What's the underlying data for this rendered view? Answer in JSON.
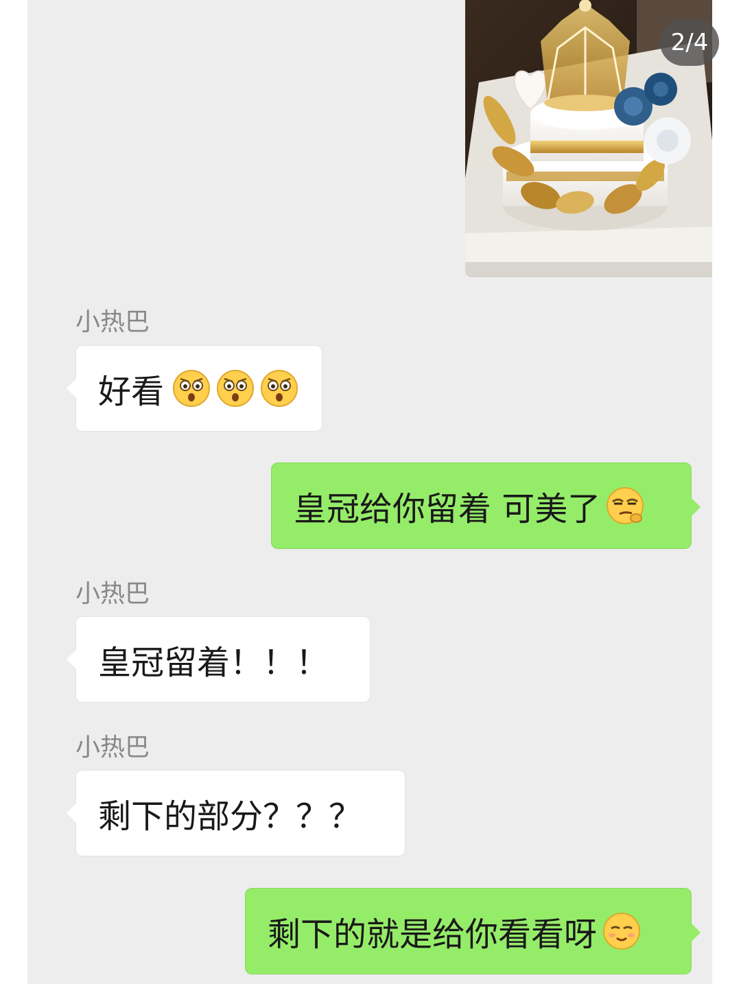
{
  "viewer": {
    "page_indicator": "2/4"
  },
  "photo": {
    "icon": "cake-photo"
  },
  "messages": [
    {
      "sender": "小热巴",
      "text": "好看",
      "emojis": [
        "surprised-face",
        "surprised-face",
        "surprised-face"
      ]
    },
    {
      "text": "皇冠给你留着 可美了",
      "emojis": [
        "smug-face"
      ]
    },
    {
      "sender": "小热巴",
      "text": "皇冠留着！！！"
    },
    {
      "sender": "小热巴",
      "text": "剩下的部分？？？"
    },
    {
      "text": "剩下的就是给你看看呀",
      "emojis": [
        "shy-smile-face"
      ]
    }
  ],
  "colors": {
    "chat_background": "#ededed",
    "incoming_bubble": "#ffffff",
    "outgoing_bubble": "#95ec69",
    "sender_name": "#888888",
    "text": "#191919"
  }
}
